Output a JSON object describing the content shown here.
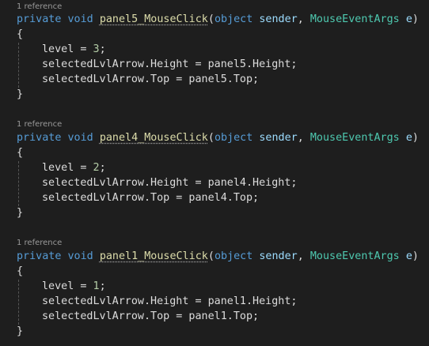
{
  "colors": {
    "background": "#1e1e1e",
    "keyword": "#569cd6",
    "method": "#dcdcaa",
    "type": "#4ec9b0",
    "parameter": "#9cdcfe",
    "number": "#b5cea8",
    "text": "#dcdcdc",
    "codelens": "#999999"
  },
  "methods": [
    {
      "codelens": "1 reference",
      "kw_private": "private",
      "kw_void": "void",
      "name": "panel5_MouseClick",
      "open_paren": "(",
      "kw_object": "object",
      "param_sender": "sender",
      "comma": ",",
      "type_args": "MouseEventArgs",
      "param_e": "e",
      "close_paren": ")",
      "open_brace": "{",
      "level_var": "level",
      "level_op": " = ",
      "level_val": "3",
      "semi": ";",
      "height_stmt": "selectedLvlArrow.Height = panel5.Height;",
      "top_stmt": "selectedLvlArrow.Top = panel5.Top;",
      "close_brace": "}"
    },
    {
      "codelens": "1 reference",
      "kw_private": "private",
      "kw_void": "void",
      "name": "panel4_MouseClick",
      "open_paren": "(",
      "kw_object": "object",
      "param_sender": "sender",
      "comma": ",",
      "type_args": "MouseEventArgs",
      "param_e": "e",
      "close_paren": ")",
      "open_brace": "{",
      "level_var": "level",
      "level_op": " = ",
      "level_val": "2",
      "semi": ";",
      "height_stmt": "selectedLvlArrow.Height = panel4.Height;",
      "top_stmt": "selectedLvlArrow.Top = panel4.Top;",
      "close_brace": "}"
    },
    {
      "codelens": "1 reference",
      "kw_private": "private",
      "kw_void": "void",
      "name": "panel1_MouseClick",
      "open_paren": "(",
      "kw_object": "object",
      "param_sender": "sender",
      "comma": ",",
      "type_args": "MouseEventArgs",
      "param_e": "e",
      "close_paren": ")",
      "open_brace": "{",
      "level_var": "level",
      "level_op": " = ",
      "level_val": "1",
      "semi": ";",
      "height_stmt": "selectedLvlArrow.Height = panel1.Height;",
      "top_stmt": "selectedLvlArrow.Top = panel1.Top;",
      "close_brace": "}"
    }
  ]
}
